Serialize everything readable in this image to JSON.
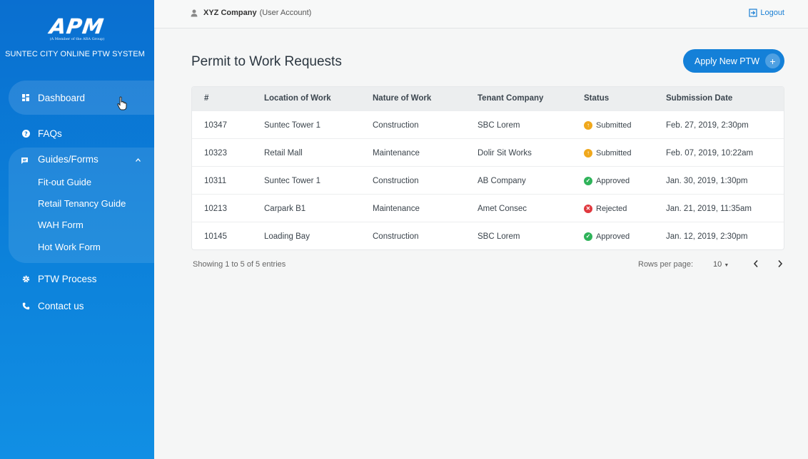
{
  "brand": {
    "logo_text": "APM",
    "logo_subtext": "(A Member of the ARA Group)",
    "system_title": "SUNTEC CITY ONLINE PTW SYSTEM"
  },
  "sidebar": {
    "dashboard": "Dashboard",
    "faqs": "FAQs",
    "guides_label": "Guides/Forms",
    "guides": [
      "Fit-out Guide",
      "Retail Tenancy Guide",
      "WAH Form",
      "Hot Work Form"
    ],
    "ptw_process": "PTW Process",
    "contact": "Contact us"
  },
  "topbar": {
    "company": "XYZ Company",
    "account_type": "(User Account)",
    "logout": "Logout"
  },
  "main": {
    "title": "Permit to Work Requests",
    "apply_button": "Apply New PTW",
    "apply_plus": "+"
  },
  "table": {
    "headers": [
      "#",
      "Location of Work",
      "Nature of Work",
      "Tenant Company",
      "Status",
      "Submission Date"
    ],
    "rows": [
      {
        "id": "10347",
        "location": "Suntec Tower 1",
        "nature": "Construction",
        "tenant": "SBC Lorem",
        "status": "Submitted",
        "date": "Feb. 27, 2019, 2:30pm"
      },
      {
        "id": "10323",
        "location": "Retail Mall",
        "nature": "Maintenance",
        "tenant": "Dolir Sit Works",
        "status": "Submitted",
        "date": "Feb. 07, 2019, 10:22am"
      },
      {
        "id": "10311",
        "location": "Suntec Tower 1",
        "nature": "Construction",
        "tenant": "AB Company",
        "status": "Approved",
        "date": "Jan. 30, 2019, 1:30pm"
      },
      {
        "id": "10213",
        "location": "Carpark B1",
        "nature": "Maintenance",
        "tenant": "Amet Consec",
        "status": "Rejected",
        "date": "Jan. 21, 2019, 11:35am"
      },
      {
        "id": "10145",
        "location": "Loading Bay",
        "nature": "Construction",
        "tenant": "SBC Lorem",
        "status": "Approved",
        "date": "Jan. 12, 2019, 2:30pm"
      }
    ]
  },
  "pagination": {
    "showing": "Showing 1 to 5 of 5 entries",
    "rows_per_page_label": "Rows per page:",
    "rows_per_page_value": "10",
    "prev_icon": "chevron-left-icon",
    "next_icon": "chevron-right-icon"
  },
  "colors": {
    "sidebar": "#0b7ed8",
    "accent": "#1480d8",
    "submitted": "#f0a81c",
    "approved": "#2fb35a",
    "rejected": "#e0383e"
  },
  "icons": {
    "dashboard": "dashboard-icon",
    "faqs": "help-circle-icon",
    "guides": "message-icon",
    "ptw": "gear-icon",
    "contact": "phone-icon",
    "user": "user-icon",
    "logout": "logout-icon"
  }
}
